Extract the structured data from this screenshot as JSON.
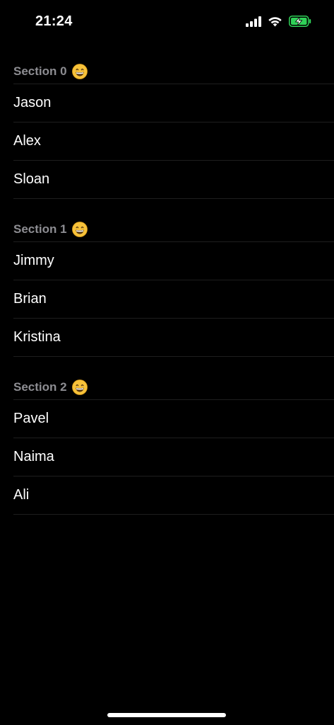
{
  "status_bar": {
    "time": "21:24",
    "icons": [
      "cellular-signal-icon",
      "wifi-icon",
      "battery-charging-icon"
    ],
    "battery_color": "#30d158"
  },
  "sections": [
    {
      "title": "Section 0",
      "emoji": "grinning-face-icon",
      "rows": [
        "Jason",
        "Alex",
        "Sloan"
      ]
    },
    {
      "title": "Section 1",
      "emoji": "grinning-face-icon",
      "rows": [
        "Jimmy",
        "Brian",
        "Kristina"
      ]
    },
    {
      "title": "Section 2",
      "emoji": "grinning-face-icon",
      "rows": [
        "Pavel",
        "Naima",
        "Ali"
      ]
    }
  ],
  "colors": {
    "background": "#000000",
    "header_text": "#8d8d92",
    "row_text": "#ffffff",
    "separator": "#1e1e1e"
  }
}
